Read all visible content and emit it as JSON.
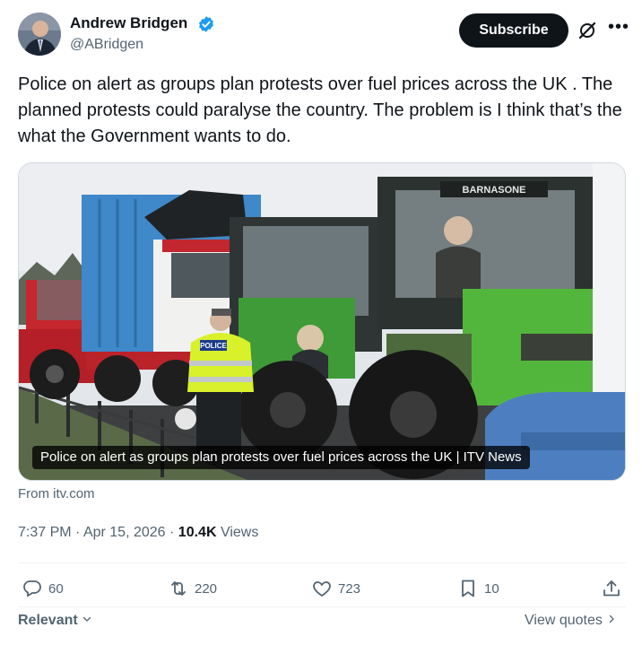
{
  "author": {
    "name": "Andrew Bridgen",
    "handle": "@ABridgen",
    "verified_color": "#1d9bf0"
  },
  "header": {
    "subscribe_label": "Subscribe"
  },
  "tweet": {
    "text": "Police on alert as groups plan protests over fuel prices across the UK . The planned protests could paralyse the country. The problem is I think that’s the what the Government wants to do.",
    "media_caption": "Police on alert as groups plan protests over fuel prices across the UK | ITV News",
    "police_label": "POLICE",
    "tractor_brand": "BARNASONE",
    "source": "From itv.com",
    "time": "7:37 PM",
    "date": "Apr 15, 2026",
    "separator": "·",
    "views_count": "10.4K",
    "views_label": "Views"
  },
  "actions": {
    "replies": "60",
    "reposts": "220",
    "likes": "723",
    "bookmarks": "10"
  },
  "footer": {
    "sort_label": "Relevant",
    "view_quotes_label": "View quotes"
  },
  "colors": {
    "text_primary": "#0f1419",
    "text_secondary": "#536471",
    "verified": "#1d9bf0",
    "divider": "#eff3f4"
  }
}
